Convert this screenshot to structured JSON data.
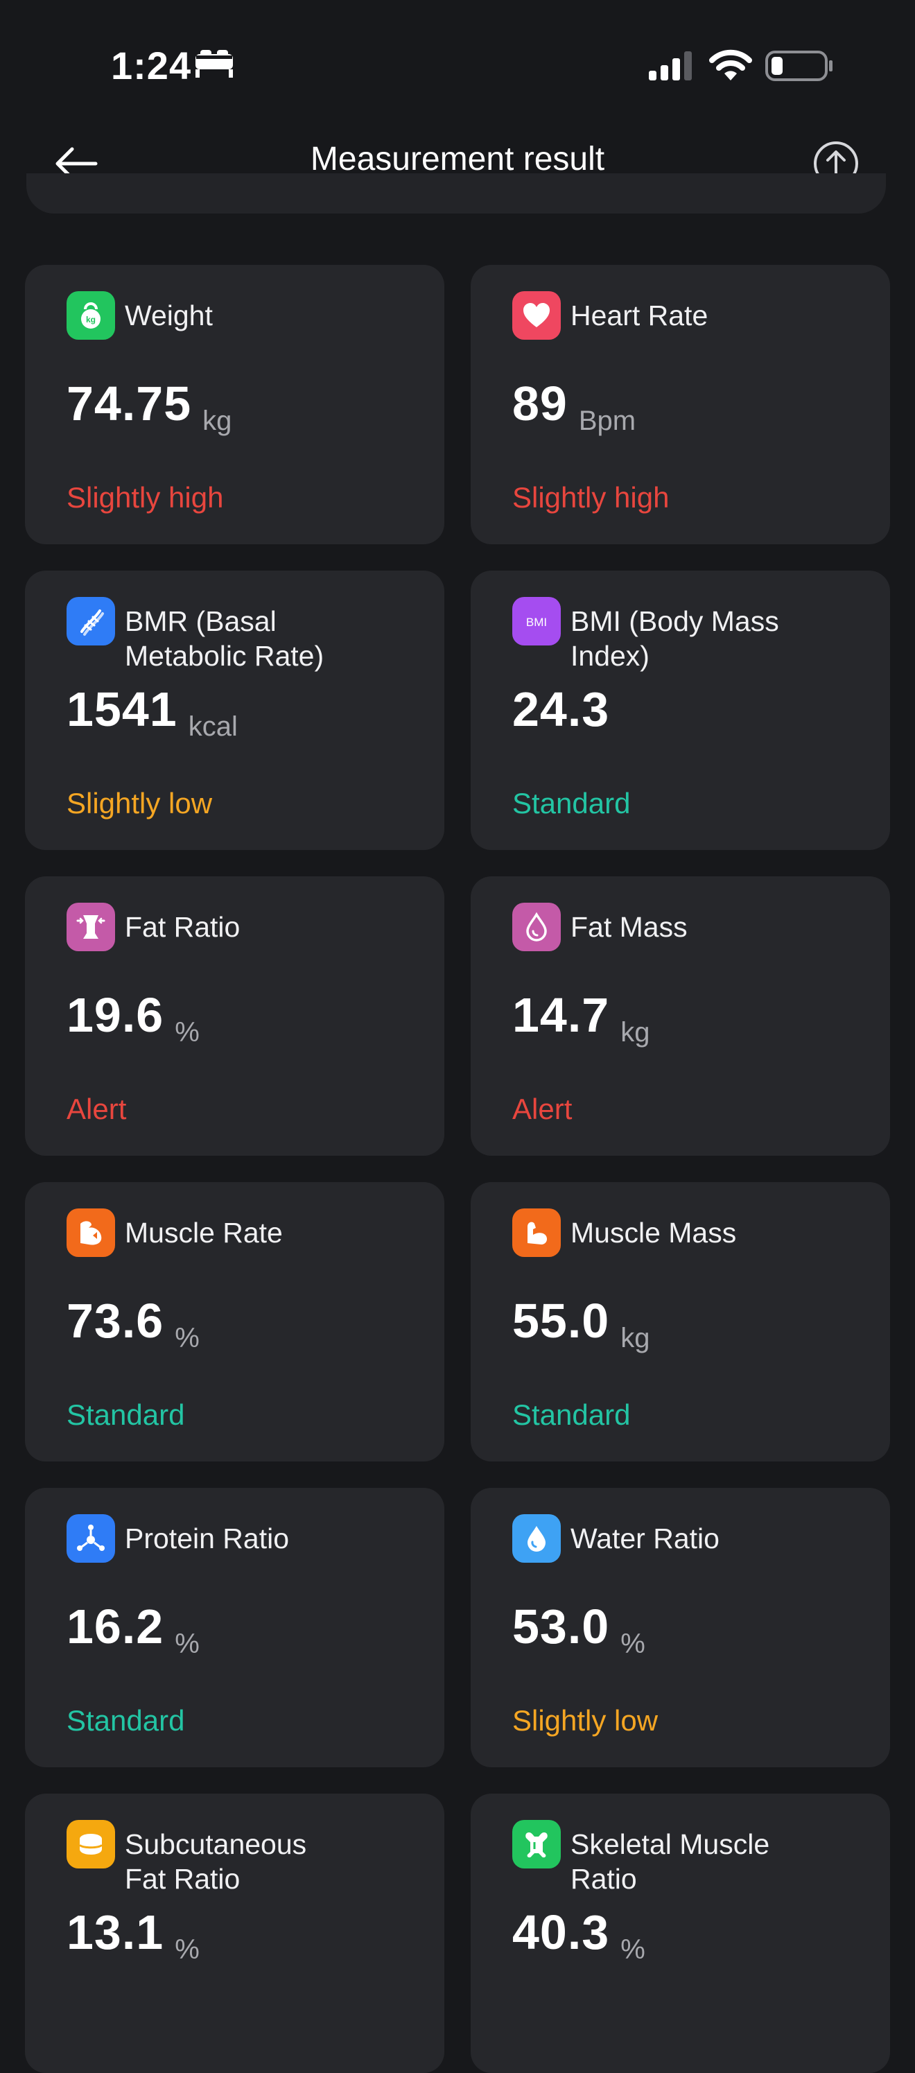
{
  "status_bar": {
    "time": "1:24"
  },
  "header": {
    "title": "Measurement result"
  },
  "colors": {
    "background": "#17181b",
    "card": "#26272b",
    "status_high": "#e8463e",
    "status_low": "#f5a623",
    "status_standard": "#23c5a4"
  },
  "metrics": [
    {
      "name": "Weight",
      "value": "74.75",
      "unit": "kg",
      "status": "Slightly high",
      "status_color": "#e8463e",
      "icon": "weight-kettlebell-icon",
      "icon_color": "#22c55e"
    },
    {
      "name": "Heart Rate",
      "value": "89",
      "unit": "Bpm",
      "status": "Slightly high",
      "status_color": "#e8463e",
      "icon": "heart-icon",
      "icon_color": "#ef4760"
    },
    {
      "name": "BMR (Basal Metabolic Rate)",
      "value": "1541",
      "unit": "kcal",
      "status": "Slightly low",
      "status_color": "#f5a623",
      "icon": "dna-icon",
      "icon_color": "#2f7cf6"
    },
    {
      "name": "BMI (Body Mass Index)",
      "value": "24.3",
      "unit": "",
      "status": "Standard",
      "status_color": "#23c5a4",
      "icon": "bmi-icon",
      "icon_color": "#a54df0"
    },
    {
      "name": "Fat Ratio",
      "value": "19.6",
      "unit": "%",
      "status": "Alert",
      "status_color": "#e8463e",
      "icon": "fat-ratio-icon",
      "icon_color": "#c45aa8"
    },
    {
      "name": "Fat Mass",
      "value": "14.7",
      "unit": "kg",
      "status": "Alert",
      "status_color": "#e8463e",
      "icon": "fat-drop-icon",
      "icon_color": "#c45aa8"
    },
    {
      "name": "Muscle Rate",
      "value": "73.6",
      "unit": "%",
      "status": "Standard",
      "status_color": "#23c5a4",
      "icon": "muscle-rate-icon",
      "icon_color": "#f26a1b"
    },
    {
      "name": "Muscle Mass",
      "value": "55.0",
      "unit": "kg",
      "status": "Standard",
      "status_color": "#23c5a4",
      "icon": "muscle-arm-icon",
      "icon_color": "#f26a1b"
    },
    {
      "name": "Protein Ratio",
      "value": "16.2",
      "unit": "%",
      "status": "Standard",
      "status_color": "#23c5a4",
      "icon": "protein-molecule-icon",
      "icon_color": "#2f7cf6"
    },
    {
      "name": "Water Ratio",
      "value": "53.0",
      "unit": "%",
      "status": "Slightly low",
      "status_color": "#f5a623",
      "icon": "water-drop-icon",
      "icon_color": "#3ea2f4"
    },
    {
      "name": "Subcutaneous Fat Ratio",
      "value": "13.1",
      "unit": "%",
      "status": "",
      "status_color": "#e8463e",
      "icon": "subcutaneous-fat-icon",
      "icon_color": "#f5a80f"
    },
    {
      "name": "Skeletal Muscle Ratio",
      "value": "40.3",
      "unit": "%",
      "status": "",
      "status_color": "#23c5a4",
      "icon": "skeletal-muscle-icon",
      "icon_color": "#22c55e"
    }
  ]
}
